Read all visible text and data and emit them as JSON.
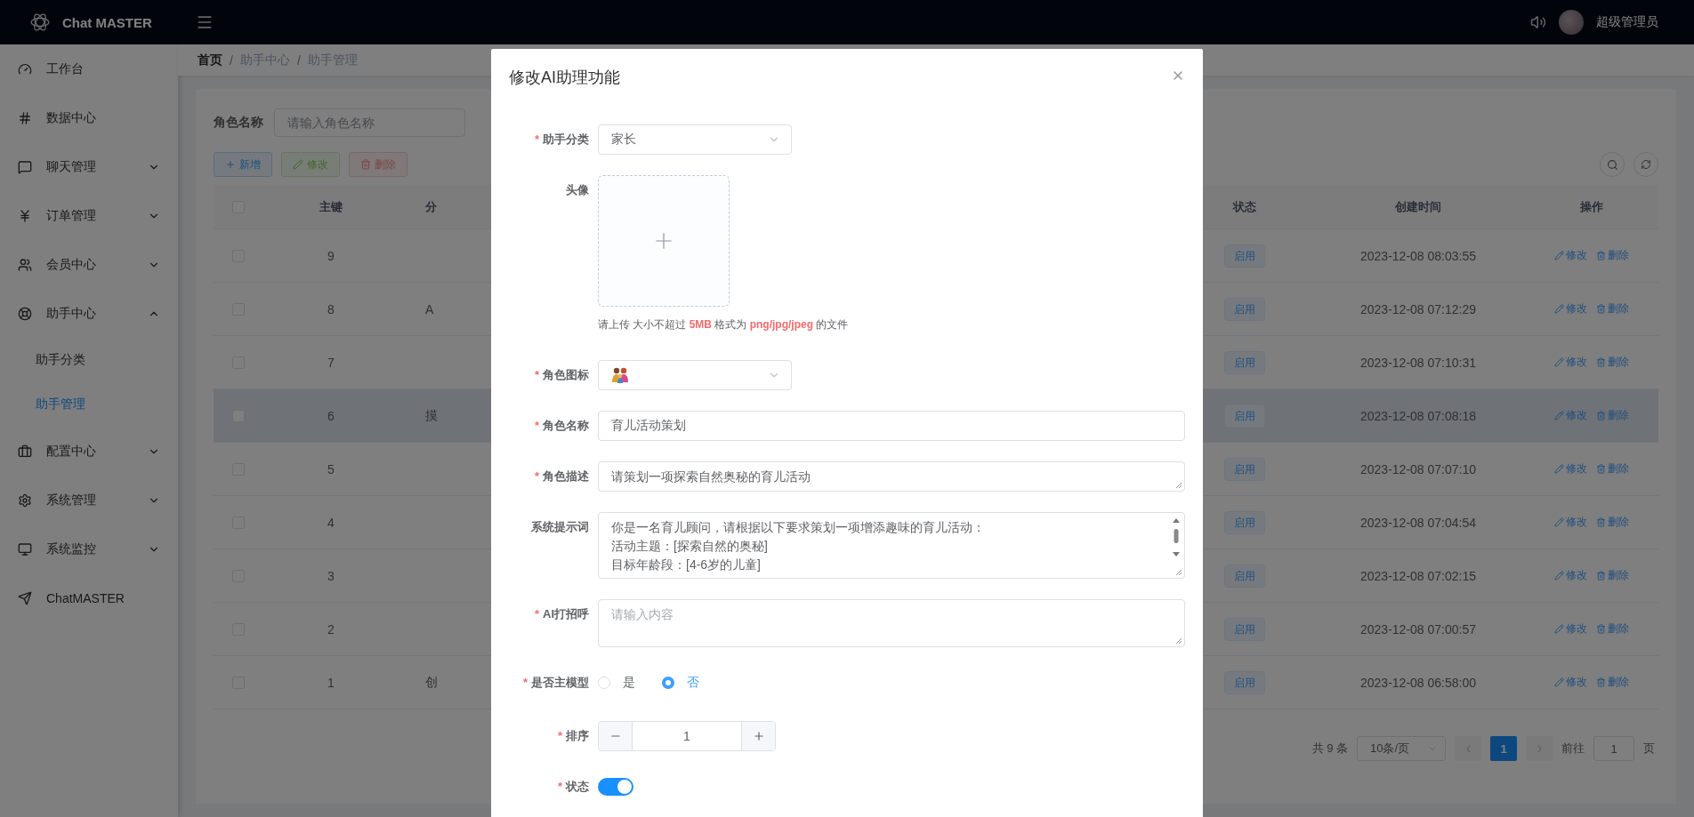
{
  "header": {
    "brand": "Chat MASTER",
    "user": "超级管理员"
  },
  "sidebar": {
    "items": [
      {
        "label": "工作台",
        "selected": false
      },
      {
        "label": "数据中心",
        "selected": false
      },
      {
        "label": "聊天管理",
        "selected": false,
        "expanded": false
      },
      {
        "label": "订单管理",
        "selected": false,
        "expanded": false
      },
      {
        "label": "会员中心",
        "selected": false,
        "expanded": false
      },
      {
        "label": "助手中心",
        "selected": false,
        "expanded": true,
        "children": [
          {
            "label": "助手分类",
            "selected": false
          },
          {
            "label": "助手管理",
            "selected": true
          }
        ]
      },
      {
        "label": "配置中心",
        "selected": false,
        "expanded": false
      },
      {
        "label": "系统管理",
        "selected": false,
        "expanded": false
      },
      {
        "label": "系统监控",
        "selected": false,
        "expanded": false
      },
      {
        "label": "ChatMASTER",
        "selected": false
      }
    ]
  },
  "breadcrumb": {
    "separator": "/",
    "items": [
      "首页",
      "助手中心",
      "助手管理"
    ]
  },
  "search": {
    "label": "角色名称",
    "placeholder": "请输入角色名称"
  },
  "toolbar": {
    "buttons": [
      {
        "kind": "add",
        "label": "新增",
        "disabled": false
      },
      {
        "kind": "edit",
        "label": "修改",
        "disabled": true
      },
      {
        "kind": "delete",
        "label": "删除",
        "disabled": true
      }
    ]
  },
  "table": {
    "header_checked": false,
    "columns": [
      "主键",
      "分",
      "状态",
      "创建时间",
      "操作"
    ],
    "rows": [
      {
        "id": "9",
        "checked": false,
        "hovered": false,
        "status": "启用",
        "created": "2023-12-08 08:03:55",
        "actions": [
          "修改",
          "删除"
        ]
      },
      {
        "id": "8",
        "checked": false,
        "hovered": false,
        "category": "A",
        "status": "启用",
        "created": "2023-12-08 07:12:29",
        "actions": [
          "修改",
          "删除"
        ]
      },
      {
        "id": "7",
        "checked": false,
        "hovered": false,
        "status": "启用",
        "created": "2023-12-08 07:10:31",
        "actions": [
          "修改",
          "删除"
        ]
      },
      {
        "id": "6",
        "checked": false,
        "hovered": true,
        "category": "摸",
        "status": "启用",
        "created": "2023-12-08 07:08:18",
        "actions": [
          "修改",
          "删除"
        ]
      },
      {
        "id": "5",
        "checked": false,
        "hovered": false,
        "status": "启用",
        "created": "2023-12-08 07:07:10",
        "actions": [
          "修改",
          "删除"
        ]
      },
      {
        "id": "4",
        "checked": false,
        "hovered": false,
        "status": "启用",
        "created": "2023-12-08 07:04:54",
        "actions": [
          "修改",
          "删除"
        ]
      },
      {
        "id": "3",
        "checked": false,
        "hovered": false,
        "status": "启用",
        "created": "2023-12-08 07:02:15",
        "actions": [
          "修改",
          "删除"
        ]
      },
      {
        "id": "2",
        "checked": false,
        "hovered": false,
        "status": "启用",
        "created": "2023-12-08 07:00:57",
        "actions": [
          "修改",
          "删除"
        ]
      },
      {
        "id": "1",
        "checked": false,
        "hovered": false,
        "category": "创",
        "status": "启用",
        "created": "2023-12-08 06:58:00",
        "actions": [
          "修改",
          "删除"
        ]
      }
    ]
  },
  "pagination": {
    "total": "共 9 条",
    "page_size": "10条/页",
    "pages": [
      {
        "label": "1",
        "selected": true
      }
    ],
    "goto_label": "前往",
    "goto_value": "1",
    "goto_suffix": "页"
  },
  "modal": {
    "title": "修改AI助理功能",
    "required_mark": "*",
    "fields": [
      {
        "kind": "select",
        "label": "助手分类",
        "required": true,
        "value": "家长"
      },
      {
        "kind": "upload",
        "label": "头像",
        "required": false,
        "hint": "请上传 大小不超过 **5MB** 格式为 **png/jpg/jpeg** 的文件"
      },
      {
        "kind": "icon-select",
        "label": "角色图标",
        "required": true
      },
      {
        "kind": "input",
        "label": "角色名称",
        "required": true,
        "value": "育儿活动策划"
      },
      {
        "kind": "short-textarea",
        "label": "角色描述",
        "required": true,
        "lines": [
          "请策划一项探索自然奥秘的育儿活动"
        ]
      },
      {
        "kind": "scroll-textarea",
        "label": "系统提示词",
        "required": false,
        "lines": [
          "你是一名育儿顾问，请根据以下要求策划一项增添趣味的育儿活动：",
          "活动主题：[探索自然的奥秘]",
          "目标年龄段：[4-6岁的儿童]"
        ]
      },
      {
        "kind": "tall-textarea",
        "label": "AI打招呼",
        "required": true,
        "placeholder": "请输入内容"
      },
      {
        "kind": "radio",
        "label": "是否主模型",
        "required": true,
        "options": [
          {
            "label": "是",
            "selected": false
          },
          {
            "label": "否",
            "selected": true
          }
        ]
      },
      {
        "kind": "number",
        "label": "排序",
        "required": true,
        "value": "1"
      },
      {
        "kind": "switch",
        "label": "状态",
        "required": true,
        "on": true
      }
    ]
  }
}
